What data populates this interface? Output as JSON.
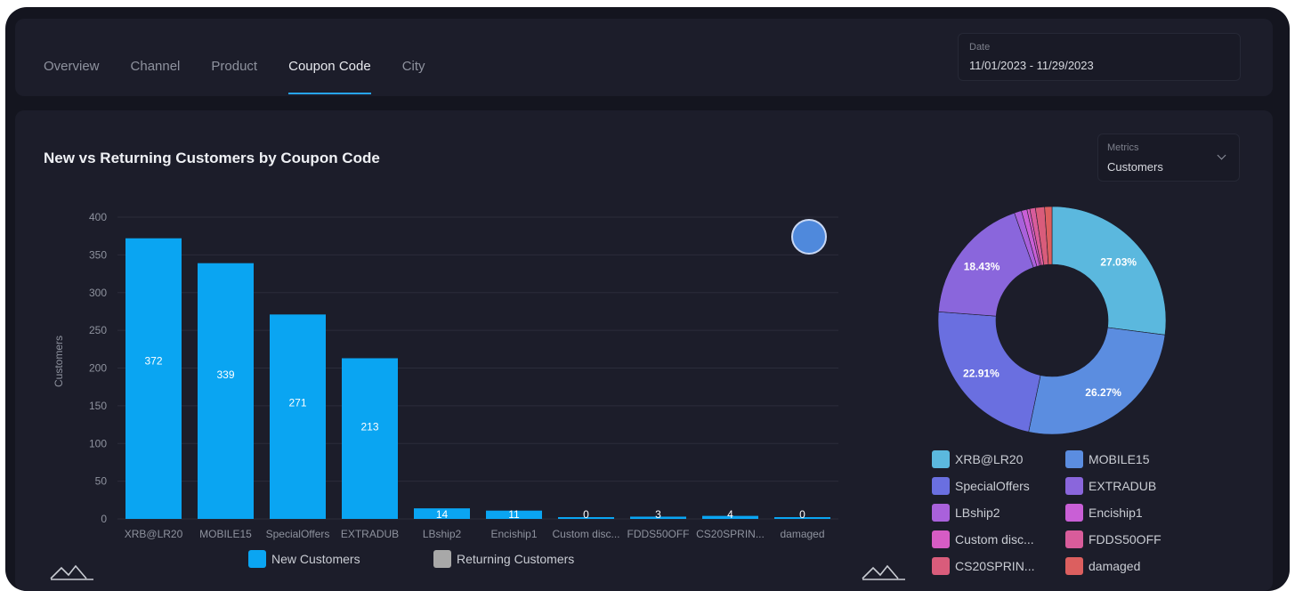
{
  "tabs": [
    {
      "label": "Overview",
      "active": false
    },
    {
      "label": "Channel",
      "active": false
    },
    {
      "label": "Product",
      "active": false
    },
    {
      "label": "Coupon Code",
      "active": true
    },
    {
      "label": "City",
      "active": false
    }
  ],
  "date_filter": {
    "label": "Date",
    "value": "11/01/2023 - 11/29/2023"
  },
  "panel": {
    "title": "New vs Returning Customers by Coupon Code",
    "metrics": {
      "label": "Metrics",
      "value": "Customers"
    }
  },
  "colors": {
    "bar": "#0aa5f2",
    "returning": "#a8a8a8",
    "grid": "#2b2d3b",
    "axis_text": "#8e929e"
  },
  "chart_data": [
    {
      "type": "bar",
      "title": "",
      "xlabel": "",
      "ylabel": "Customers",
      "ylim": [
        0,
        400
      ],
      "yticks": [
        0,
        50,
        100,
        150,
        200,
        250,
        300,
        350,
        400
      ],
      "categories": [
        "XRB@LR20",
        "MOBILE15",
        "SpecialOffers",
        "EXTRADUB",
        "LBship2",
        "Enciship1",
        "Custom disc...",
        "FDDS50OFF",
        "CS20SPRIN...",
        "damaged"
      ],
      "series": [
        {
          "name": "New Customers",
          "values": [
            372,
            339,
            271,
            213,
            14,
            11,
            0,
            3,
            4,
            0
          ]
        },
        {
          "name": "Returning Customers",
          "values": [
            0,
            0,
            0,
            0,
            0,
            0,
            0,
            0,
            0,
            0
          ]
        }
      ],
      "data_labels": [
        "372",
        "339",
        "271",
        "213",
        "14",
        "11",
        "0",
        "3",
        "4",
        "0"
      ],
      "legend": "bottom",
      "grid": true
    },
    {
      "type": "pie",
      "donut": true,
      "labels": [
        "XRB@LR20",
        "MOBILE15",
        "SpecialOffers",
        "EXTRADUB",
        "LBship2",
        "Enciship1",
        "Custom disc...",
        "FDDS50OFF",
        "CS20SPRIN...",
        "damaged"
      ],
      "values": [
        27.03,
        26.27,
        22.91,
        18.43,
        1.02,
        0.8,
        0.4,
        0.8,
        1.3,
        1.04
      ],
      "slice_labels": [
        "27.03%",
        "26.27%",
        "22.91%",
        "18.43%",
        "",
        "",
        "",
        "",
        "",
        ""
      ],
      "colors": [
        "#5bb8de",
        "#5b8de0",
        "#6a6fe0",
        "#8a66dc",
        "#a961db",
        "#c95fd6",
        "#d65cc4",
        "#d85c9b",
        "#d95c7b",
        "#dc5f5f"
      ],
      "legend": "bottom"
    }
  ]
}
